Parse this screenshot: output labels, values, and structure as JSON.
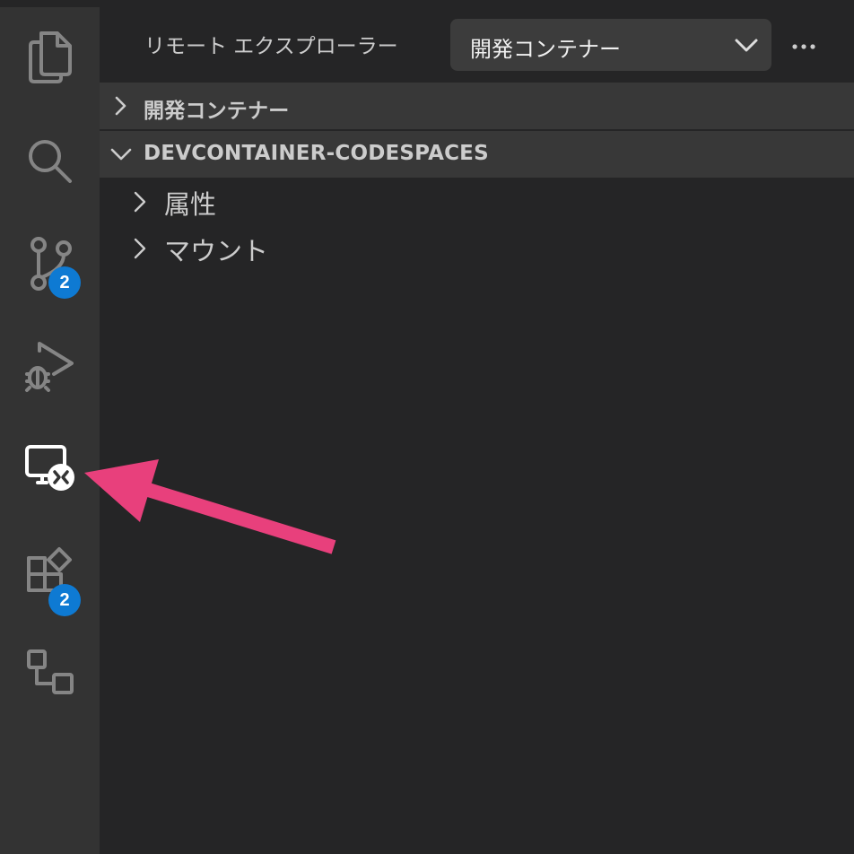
{
  "activity_bar": {
    "items": [
      {
        "name": "explorer",
        "icon": "files-icon",
        "active": false
      },
      {
        "name": "search",
        "icon": "search-icon",
        "active": false
      },
      {
        "name": "source-control",
        "icon": "source-control-icon",
        "active": false,
        "badge": "2"
      },
      {
        "name": "run-debug",
        "icon": "run-debug-icon",
        "active": false
      },
      {
        "name": "remote-explorer",
        "icon": "remote-explorer-icon",
        "active": true
      },
      {
        "name": "extensions",
        "icon": "extensions-icon",
        "active": false,
        "badge": "2"
      },
      {
        "name": "containers",
        "icon": "containers-icon",
        "active": false
      }
    ]
  },
  "sidebar": {
    "title": "リモート エクスプローラー",
    "dropdown": {
      "selected": "開発コンテナー"
    },
    "more_icon": "ellipsis-icon",
    "sections": [
      {
        "label": "開発コンテナー",
        "expanded": false
      },
      {
        "label": "DEVCONTAINER-CODESPACES",
        "expanded": true,
        "items": [
          {
            "label": "属性",
            "expanded": false
          },
          {
            "label": "マウント",
            "expanded": false
          }
        ]
      }
    ]
  },
  "annotation": {
    "type": "arrow",
    "color": "#e8407c",
    "target": "remote-explorer"
  },
  "colors": {
    "activity_bar_bg": "#333333",
    "sidebar_bg": "#252526",
    "section_header_bg": "#383838",
    "badge_bg": "#0e7ad3",
    "icon_inactive": "#858585",
    "icon_active": "#ffffff"
  }
}
